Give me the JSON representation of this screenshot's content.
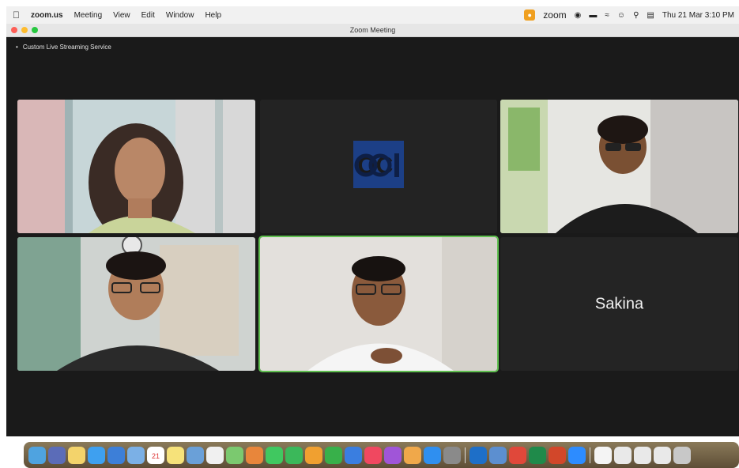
{
  "menubar": {
    "app_name": "zoom.us",
    "items": [
      "Meeting",
      "View",
      "Edit",
      "Window",
      "Help"
    ],
    "status_app": "zoom",
    "datetime": "Thu 21 Mar  3:10 PM"
  },
  "window": {
    "title": "Zoom Meeting",
    "stream_label": "Custom Live Streaming Service"
  },
  "participants": [
    {
      "name": "",
      "type": "video"
    },
    {
      "name": "",
      "type": "logo"
    },
    {
      "name": "",
      "type": "video"
    },
    {
      "name": "",
      "type": "video"
    },
    {
      "name": "",
      "type": "video",
      "active_speaker": true
    },
    {
      "name": "Sakina",
      "type": "name-only"
    }
  ],
  "dock": {
    "calendar_day": "21",
    "icons": [
      "finder-icon",
      "launchpad-icon",
      "notes-icon",
      "safari-icon",
      "mail-icon",
      "folder-icon",
      "calendar-icon",
      "notes-app-icon",
      "photos-icon",
      "reminders-icon",
      "maps-icon",
      "photos-app-icon",
      "messages-icon",
      "facetime-icon",
      "pages-icon",
      "numbers-icon",
      "keynote-icon",
      "music-icon",
      "podcasts-icon",
      "books-icon",
      "appstore-icon",
      "settings-icon",
      "outlook-icon",
      "preview-icon",
      "chrome-icon",
      "excel-icon",
      "powerpoint-icon",
      "zoom-icon",
      "document-icon",
      "file-icon",
      "file2-icon",
      "file3-icon",
      "trash-icon"
    ]
  },
  "colors": {
    "active_border": "#5fbf4f",
    "window_bg": "#1a1a1a",
    "tile_bg": "#222222"
  }
}
